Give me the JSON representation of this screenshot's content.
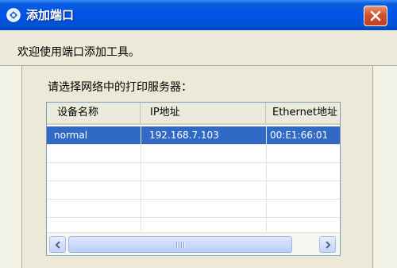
{
  "window": {
    "title": "添加端口",
    "icon": "network-printer-icon",
    "close_icon": "close-icon"
  },
  "welcome_text": "欢迎使用端口添加工具。",
  "prompt_text": "请选择网络中的打印服务器：",
  "table": {
    "columns": [
      "设备名称",
      "IP地址",
      "Ethernet地址"
    ],
    "rows": [
      {
        "name": "normal",
        "ip": "192.168.7.103",
        "mac": "00:E1:66:01",
        "selected": true
      }
    ],
    "empty_rows": 5
  },
  "scrollbar": {
    "left_icon": "scroll-left-icon",
    "right_icon": "scroll-right-icon",
    "thumb_grip_icon": "grip-icon"
  },
  "colors": {
    "titlebar": "#0053e6",
    "selection": "#316ac5",
    "close_button": "#d0512e",
    "dialog_bg": "#ece9d8"
  }
}
